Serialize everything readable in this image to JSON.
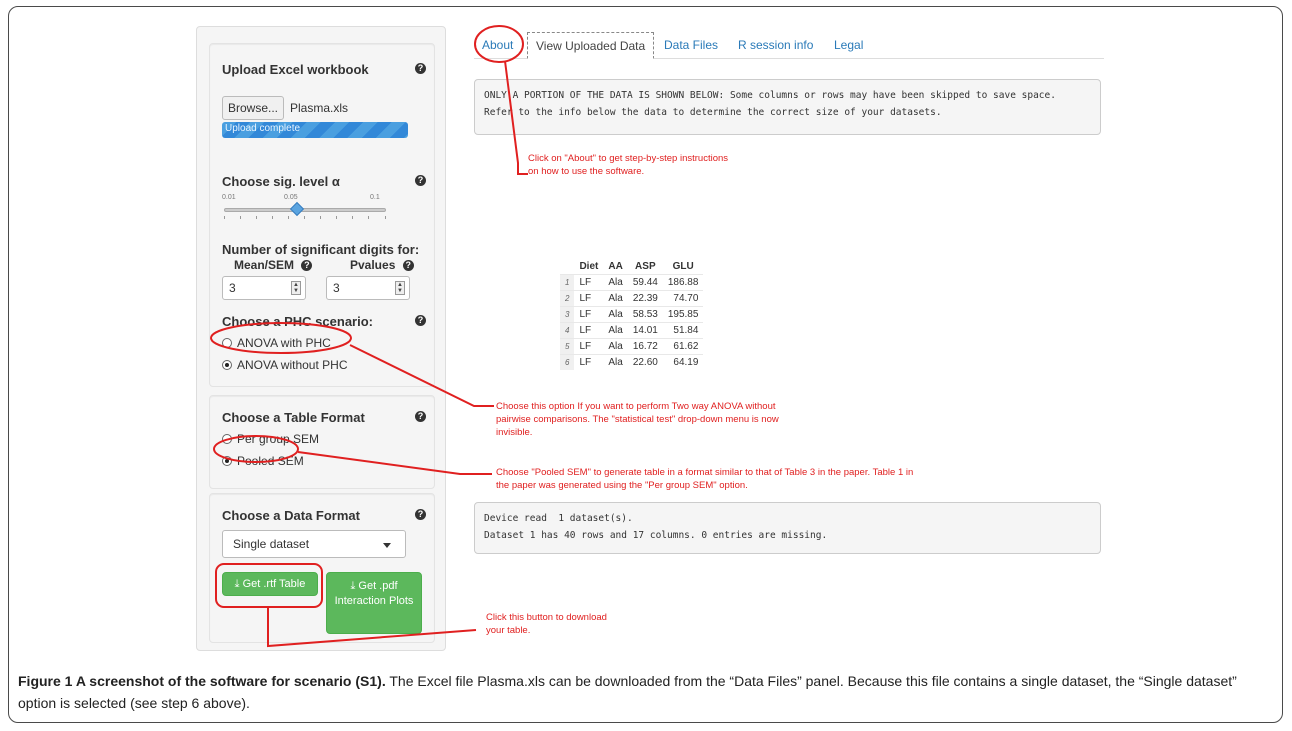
{
  "sidebar": {
    "upload": {
      "title": "Upload Excel workbook",
      "browse_label": "Browse...",
      "file_name": "Plasma.xls",
      "progress_text": "Upload complete",
      "progress": 1.0
    },
    "sig_level": {
      "title": "Choose sig. level α",
      "tick_labels": [
        "0.01",
        "0.05",
        "0.1"
      ],
      "value": 0.05
    },
    "sig_digits": {
      "title": "Number of significant digits for:",
      "mean_label": "Mean/SEM",
      "pvalues_label": "Pvalues",
      "mean_value": "3",
      "pvalues_value": "3"
    },
    "phc": {
      "title": "Choose a PHC scenario:",
      "options": [
        "ANOVA with PHC",
        "ANOVA without PHC"
      ],
      "selected": "ANOVA without PHC"
    },
    "table_format": {
      "title": "Choose a Table Format",
      "options": [
        "Per group SEM",
        "Pooled SEM"
      ],
      "selected": "Pooled SEM"
    },
    "data_format": {
      "title": "Choose a Data Format",
      "selected": "Single dataset"
    },
    "buttons": {
      "rtf_label": "Get .rtf Table",
      "pdf_label": "Get .pdf Interaction Plots"
    }
  },
  "tabs": [
    "About",
    "View Uploaded Data",
    "Data Files",
    "R session info",
    "Legal"
  ],
  "active_tab": "View Uploaded Data",
  "main": {
    "info_line1": "ONLY A PORTION OF THE DATA IS SHOWN BELOW: Some columns or rows may have been skipped to save space.",
    "info_line2": "Refer to the info below the data to determine the correct size of your datasets.",
    "table": {
      "headers": [
        "",
        "Diet",
        "AA",
        "ASP",
        "GLU"
      ],
      "rows": [
        [
          "1",
          "LF",
          "Ala",
          "59.44",
          "186.88"
        ],
        [
          "2",
          "LF",
          "Ala",
          "22.39",
          "74.70"
        ],
        [
          "3",
          "LF",
          "Ala",
          "58.53",
          "195.85"
        ],
        [
          "4",
          "LF",
          "Ala",
          "14.01",
          "51.84"
        ],
        [
          "5",
          "LF",
          "Ala",
          "16.72",
          "61.62"
        ],
        [
          "6",
          "LF",
          "Ala",
          "22.60",
          "64.19"
        ]
      ]
    },
    "status_line1": "Device read  1 dataset(s).",
    "status_line2": "Dataset 1 has 40 rows and 17 columns. 0 entries are missing."
  },
  "annotations": {
    "about": "Click on \"About\" to get step-by-step instructions on how to use the software.",
    "phc": "Choose this option If you want to perform Two way ANOVA without pairwise comparisons. The \"statistical test\" drop-down menu is now invisible.",
    "pooled": "Choose \"Pooled SEM\" to generate table in a format similar to that of Table 3 in the paper. Table 1 in the paper was generated using the \"Per group SEM\" option.",
    "button": "Click this button to download your table.",
    "color": "#e02020"
  },
  "caption": {
    "label": "Figure 1 A screenshot of the software for scenario (S1).",
    "text": " The Excel file Plasma.xls can be downloaded from the “Data Files” panel. Because this file contains a single dataset, the “Single dataset” option is selected (see step 6 above)."
  },
  "colors": {
    "link": "#2a7ab8",
    "progress": "#3288d8",
    "green_button": "#5cb85c"
  }
}
